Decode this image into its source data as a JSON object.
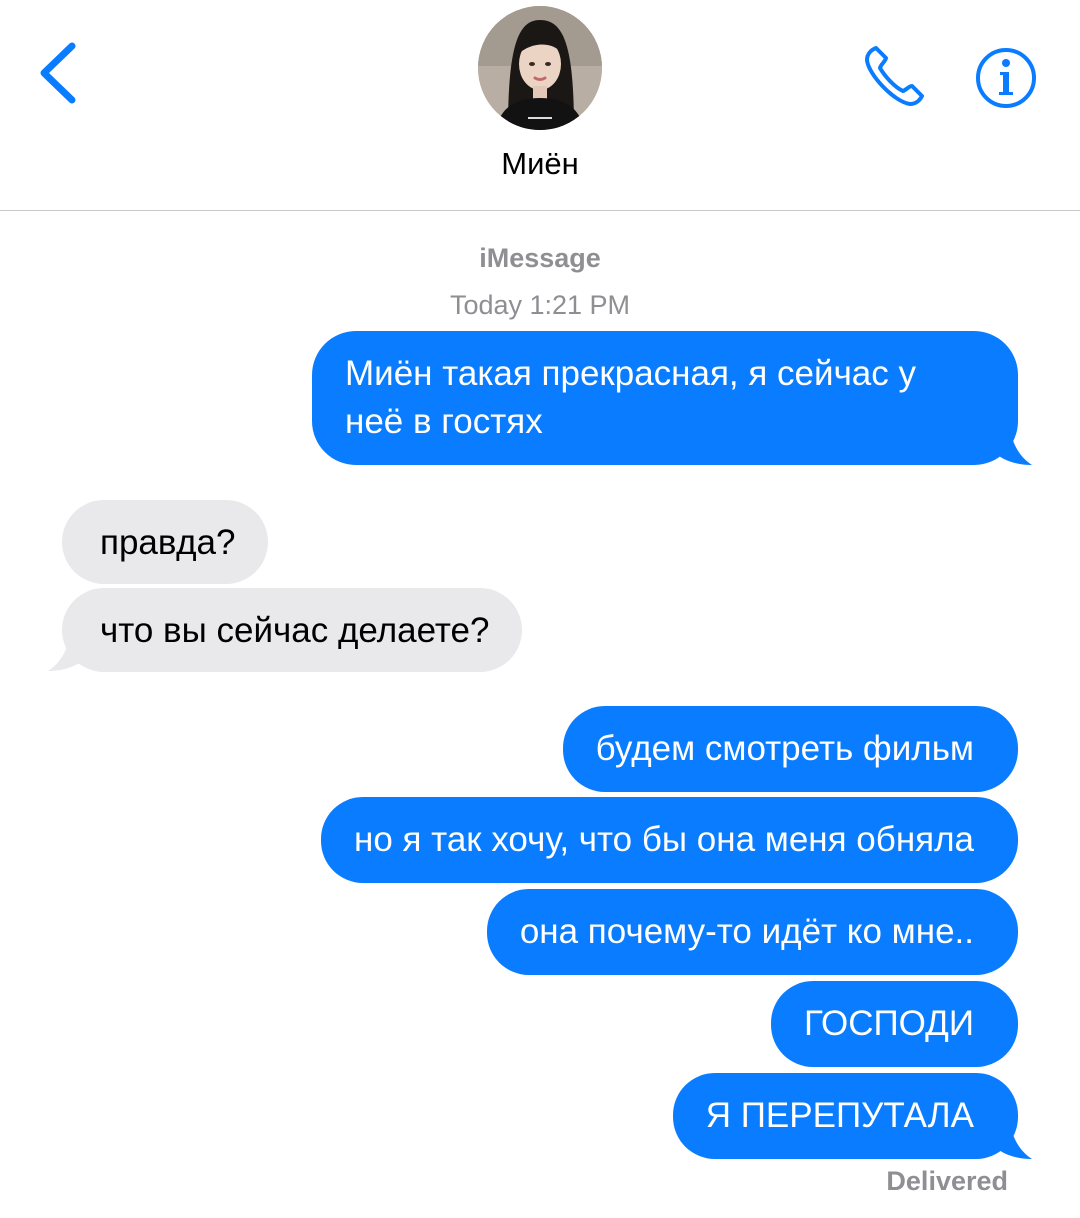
{
  "header": {
    "contact_name": "Миён",
    "back_icon": "chevron-left-icon",
    "call_icon": "phone-icon",
    "info_icon": "info-icon",
    "accent_color": "#0a7cff"
  },
  "thread": {
    "service": "iMessage",
    "timestamp": "Today 1:21 PM",
    "messages": [
      {
        "from": "me",
        "text": "Миён такая прекрасная, я сейчас у",
        "text2": "неё в гостях"
      },
      {
        "from": "them",
        "text": "правда?"
      },
      {
        "from": "them",
        "text": "что вы сейчас делаете?"
      },
      {
        "from": "me",
        "text": "будем смотреть фильм"
      },
      {
        "from": "me",
        "text": "но я так хочу, что бы она меня обняла"
      },
      {
        "from": "me",
        "text": "она почему-то идёт ко мне.."
      },
      {
        "from": "me",
        "text": "ГОСПОДИ"
      },
      {
        "from": "me",
        "text": "Я ПЕРЕПУТАЛА"
      }
    ],
    "status": "Delivered"
  },
  "colors": {
    "outgoing_bubble": "#0a7cff",
    "incoming_bubble": "#e9e9eb",
    "meta_text": "#8e8e93"
  }
}
